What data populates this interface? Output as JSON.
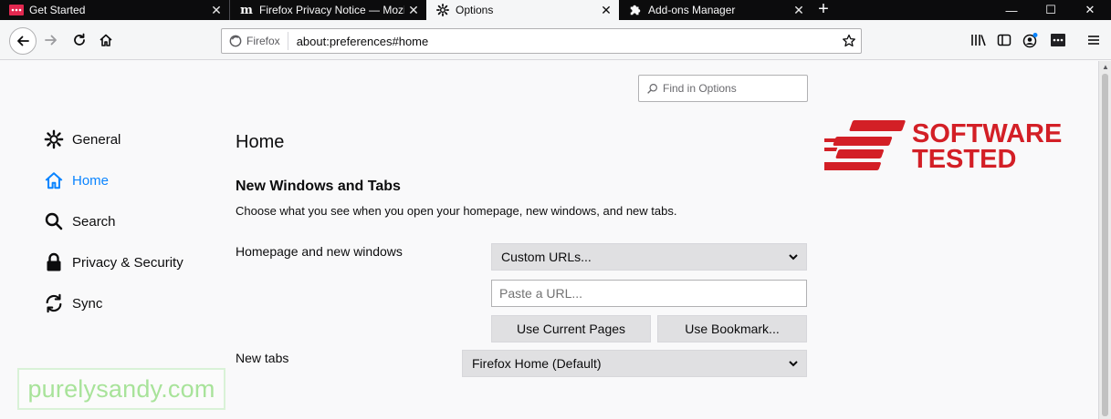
{
  "tabs": [
    {
      "label": "Get Started",
      "icon": "firefox-get-started-icon"
    },
    {
      "label": "Firefox Privacy Notice — Mozil",
      "icon": "mozilla-m-icon"
    },
    {
      "label": "Options",
      "icon": "gear-icon",
      "selected": true
    },
    {
      "label": "Add-ons Manager",
      "icon": "puzzle-icon"
    }
  ],
  "window_controls": {
    "minimize": "—",
    "maximize": "☐",
    "close": "✕"
  },
  "newtab_label": "+",
  "urlbar": {
    "identity": "Firefox",
    "url": "about:preferences#home"
  },
  "find": {
    "placeholder": "Find in Options"
  },
  "categories": [
    {
      "label": "General",
      "icon": "gear-icon"
    },
    {
      "label": "Home",
      "icon": "home-icon",
      "selected": true
    },
    {
      "label": "Search",
      "icon": "search-icon"
    },
    {
      "label": "Privacy & Security",
      "icon": "lock-icon"
    },
    {
      "label": "Sync",
      "icon": "sync-icon"
    }
  ],
  "main": {
    "title": "Home",
    "section_title": "New Windows and Tabs",
    "section_desc": "Choose what you see when you open your homepage, new windows, and new tabs.",
    "homepage_label": "Homepage and new windows",
    "homepage_value": "Custom URLs...",
    "url_placeholder": "Paste a URL...",
    "use_current_pages": "Use Current Pages",
    "use_bookmark": "Use Bookmark...",
    "newtabs_label": "New tabs",
    "newtabs_value": "Firefox Home (Default)"
  },
  "overlay": {
    "logo_line1": "SOFTWARE",
    "logo_line2": "TESTED",
    "watermark": "purelysandy.com"
  },
  "colors": {
    "accent": "#0a84ff",
    "logo_red": "#d31f26",
    "tabstrip": "#0c0c0d"
  }
}
